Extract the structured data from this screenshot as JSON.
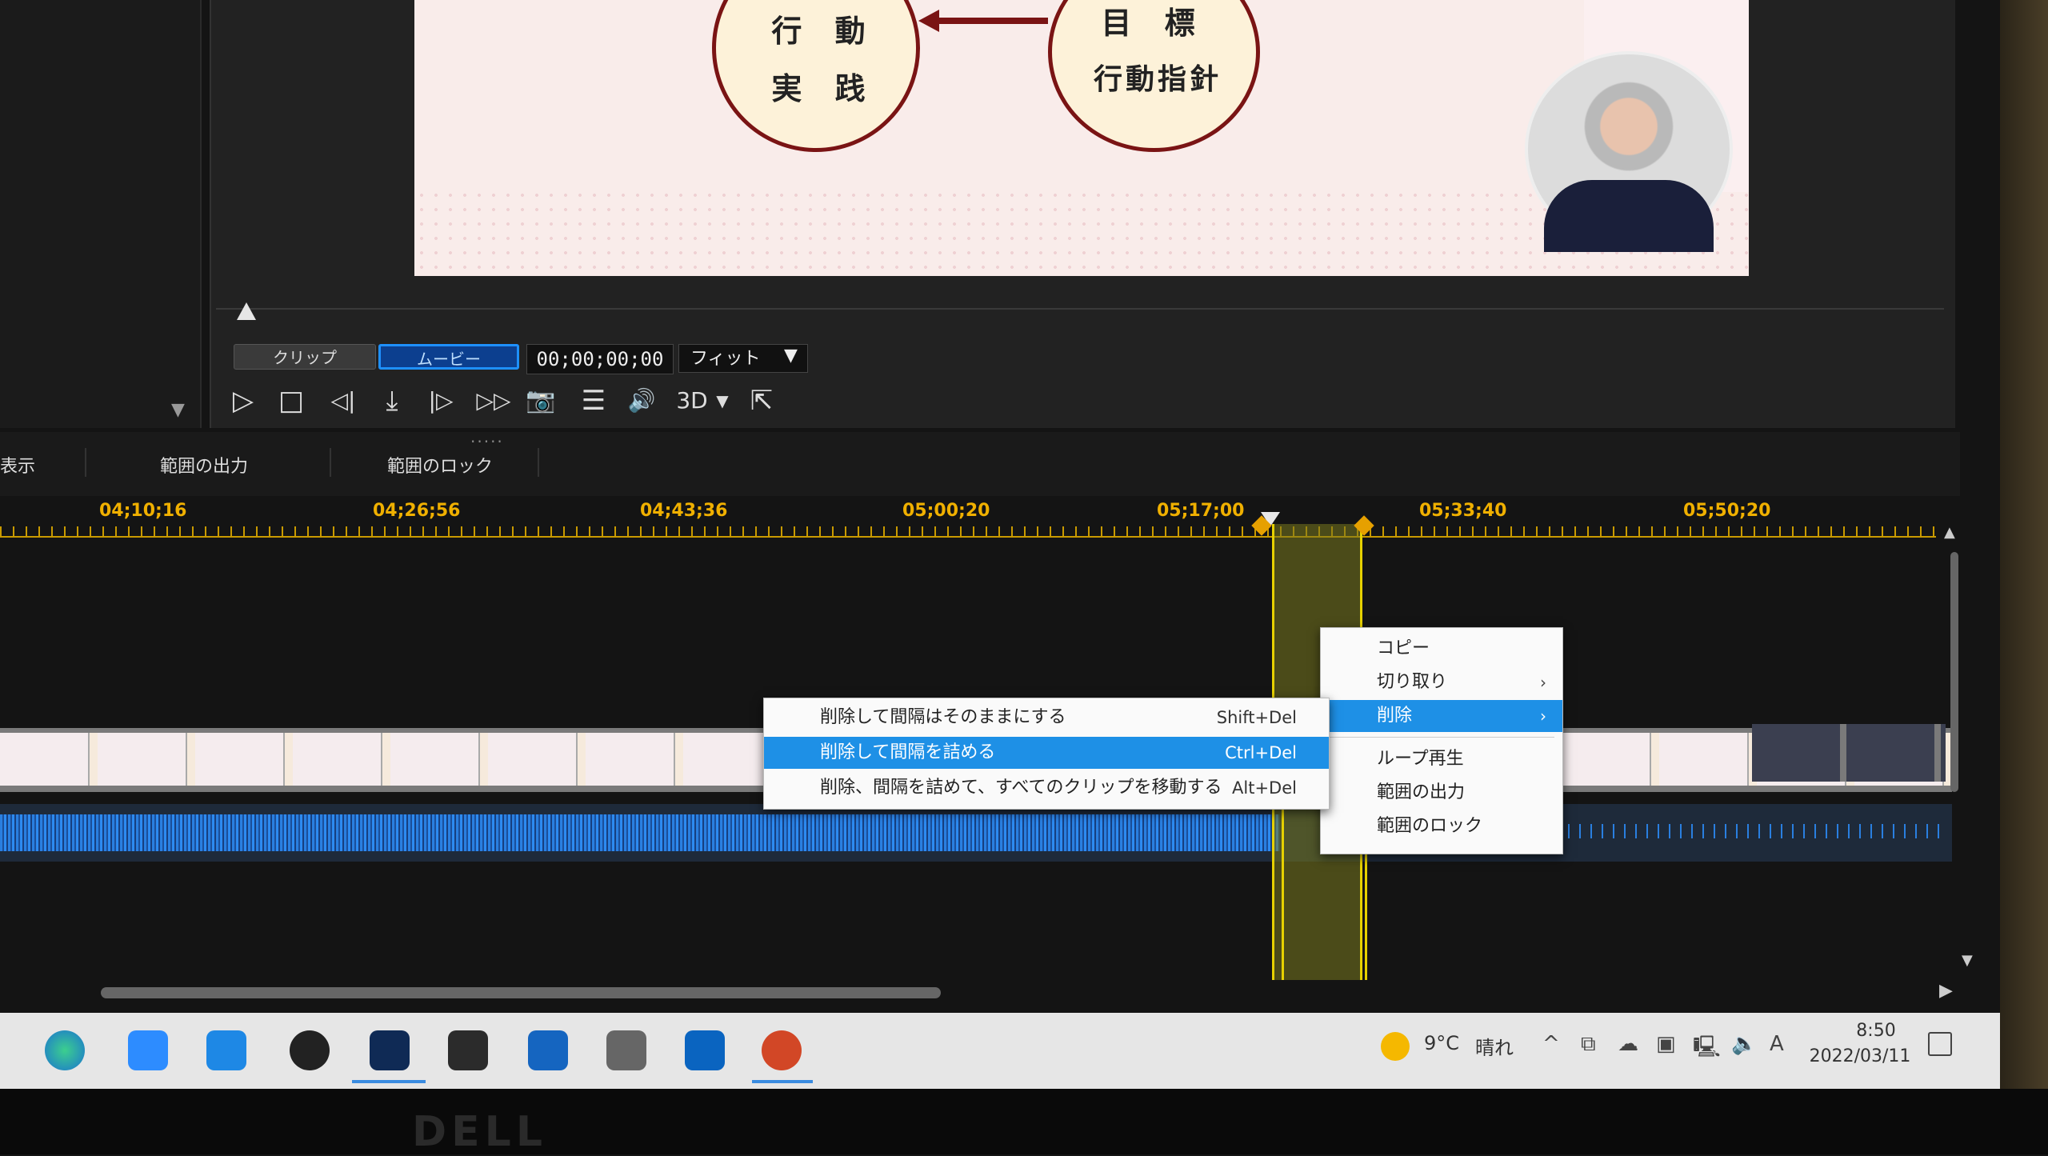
{
  "preview": {
    "oval_left_line1": "行 動",
    "oval_left_line2": "実 践",
    "oval_right_line1": "目 標",
    "oval_right_line2": "行動指針"
  },
  "player": {
    "clip_mode": "クリップ",
    "movie_mode": "ムービー",
    "timecode": "00;00;00;00",
    "fit": "フィット",
    "controls": {
      "play": "▷",
      "stop": "□",
      "prev_frame": "◁|",
      "keyframe": "⤓",
      "next_frame": "|▷",
      "fast_forward": "▷▷",
      "snapshot": "📷",
      "list": "☰",
      "volume": "🔊",
      "mode_3d": "3D",
      "mode_3d_arrow": "▼",
      "external": "⇱"
    }
  },
  "timeline_toolbar": {
    "partial_label": "表示",
    "range_output": "範囲の出力",
    "range_lock": "範囲のロック"
  },
  "ruler": {
    "labels": [
      "04;10;16",
      "04;26;56",
      "04;43;36",
      "05;00;20",
      "05;17;00",
      "05;33;40",
      "05;50;20"
    ]
  },
  "context_menu": {
    "items": [
      {
        "label": "コピー"
      },
      {
        "label": "切り取り",
        "submenu": true
      },
      {
        "label": "削除",
        "submenu": true,
        "highlighted": true
      },
      {
        "label": "ループ再生"
      },
      {
        "label": "範囲の出力"
      },
      {
        "label": "範囲のロック"
      }
    ],
    "chevron": "›"
  },
  "delete_submenu": {
    "items": [
      {
        "label": "削除して間隔はそのままにする",
        "shortcut": "Shift+Del"
      },
      {
        "label": "削除して間隔を詰める",
        "shortcut": "Ctrl+Del",
        "highlighted": true
      },
      {
        "label": "削除、間隔を詰めて、すべてのクリップを移動する",
        "shortcut": "Alt+Del"
      }
    ]
  },
  "taskbar": {
    "apps": [
      "edge-icon",
      "zoom-icon",
      "webex-icon",
      "obs-icon",
      "powerdirector-icon",
      "photodirector-icon",
      "movie-icon",
      "camera-icon",
      "outlook-icon",
      "powerpoint-icon"
    ],
    "weather_temp": "9°C",
    "weather_desc": "晴れ",
    "chevron": "^",
    "ime": "A",
    "time": "8:50",
    "date": "2022/03/11"
  },
  "monitor_brand": "DELL",
  "colors": {
    "accent": "#1e90e6",
    "timeline_ruler": "#f0b000",
    "range_marker": "#e6d100",
    "powerpoint": "#d24726"
  }
}
